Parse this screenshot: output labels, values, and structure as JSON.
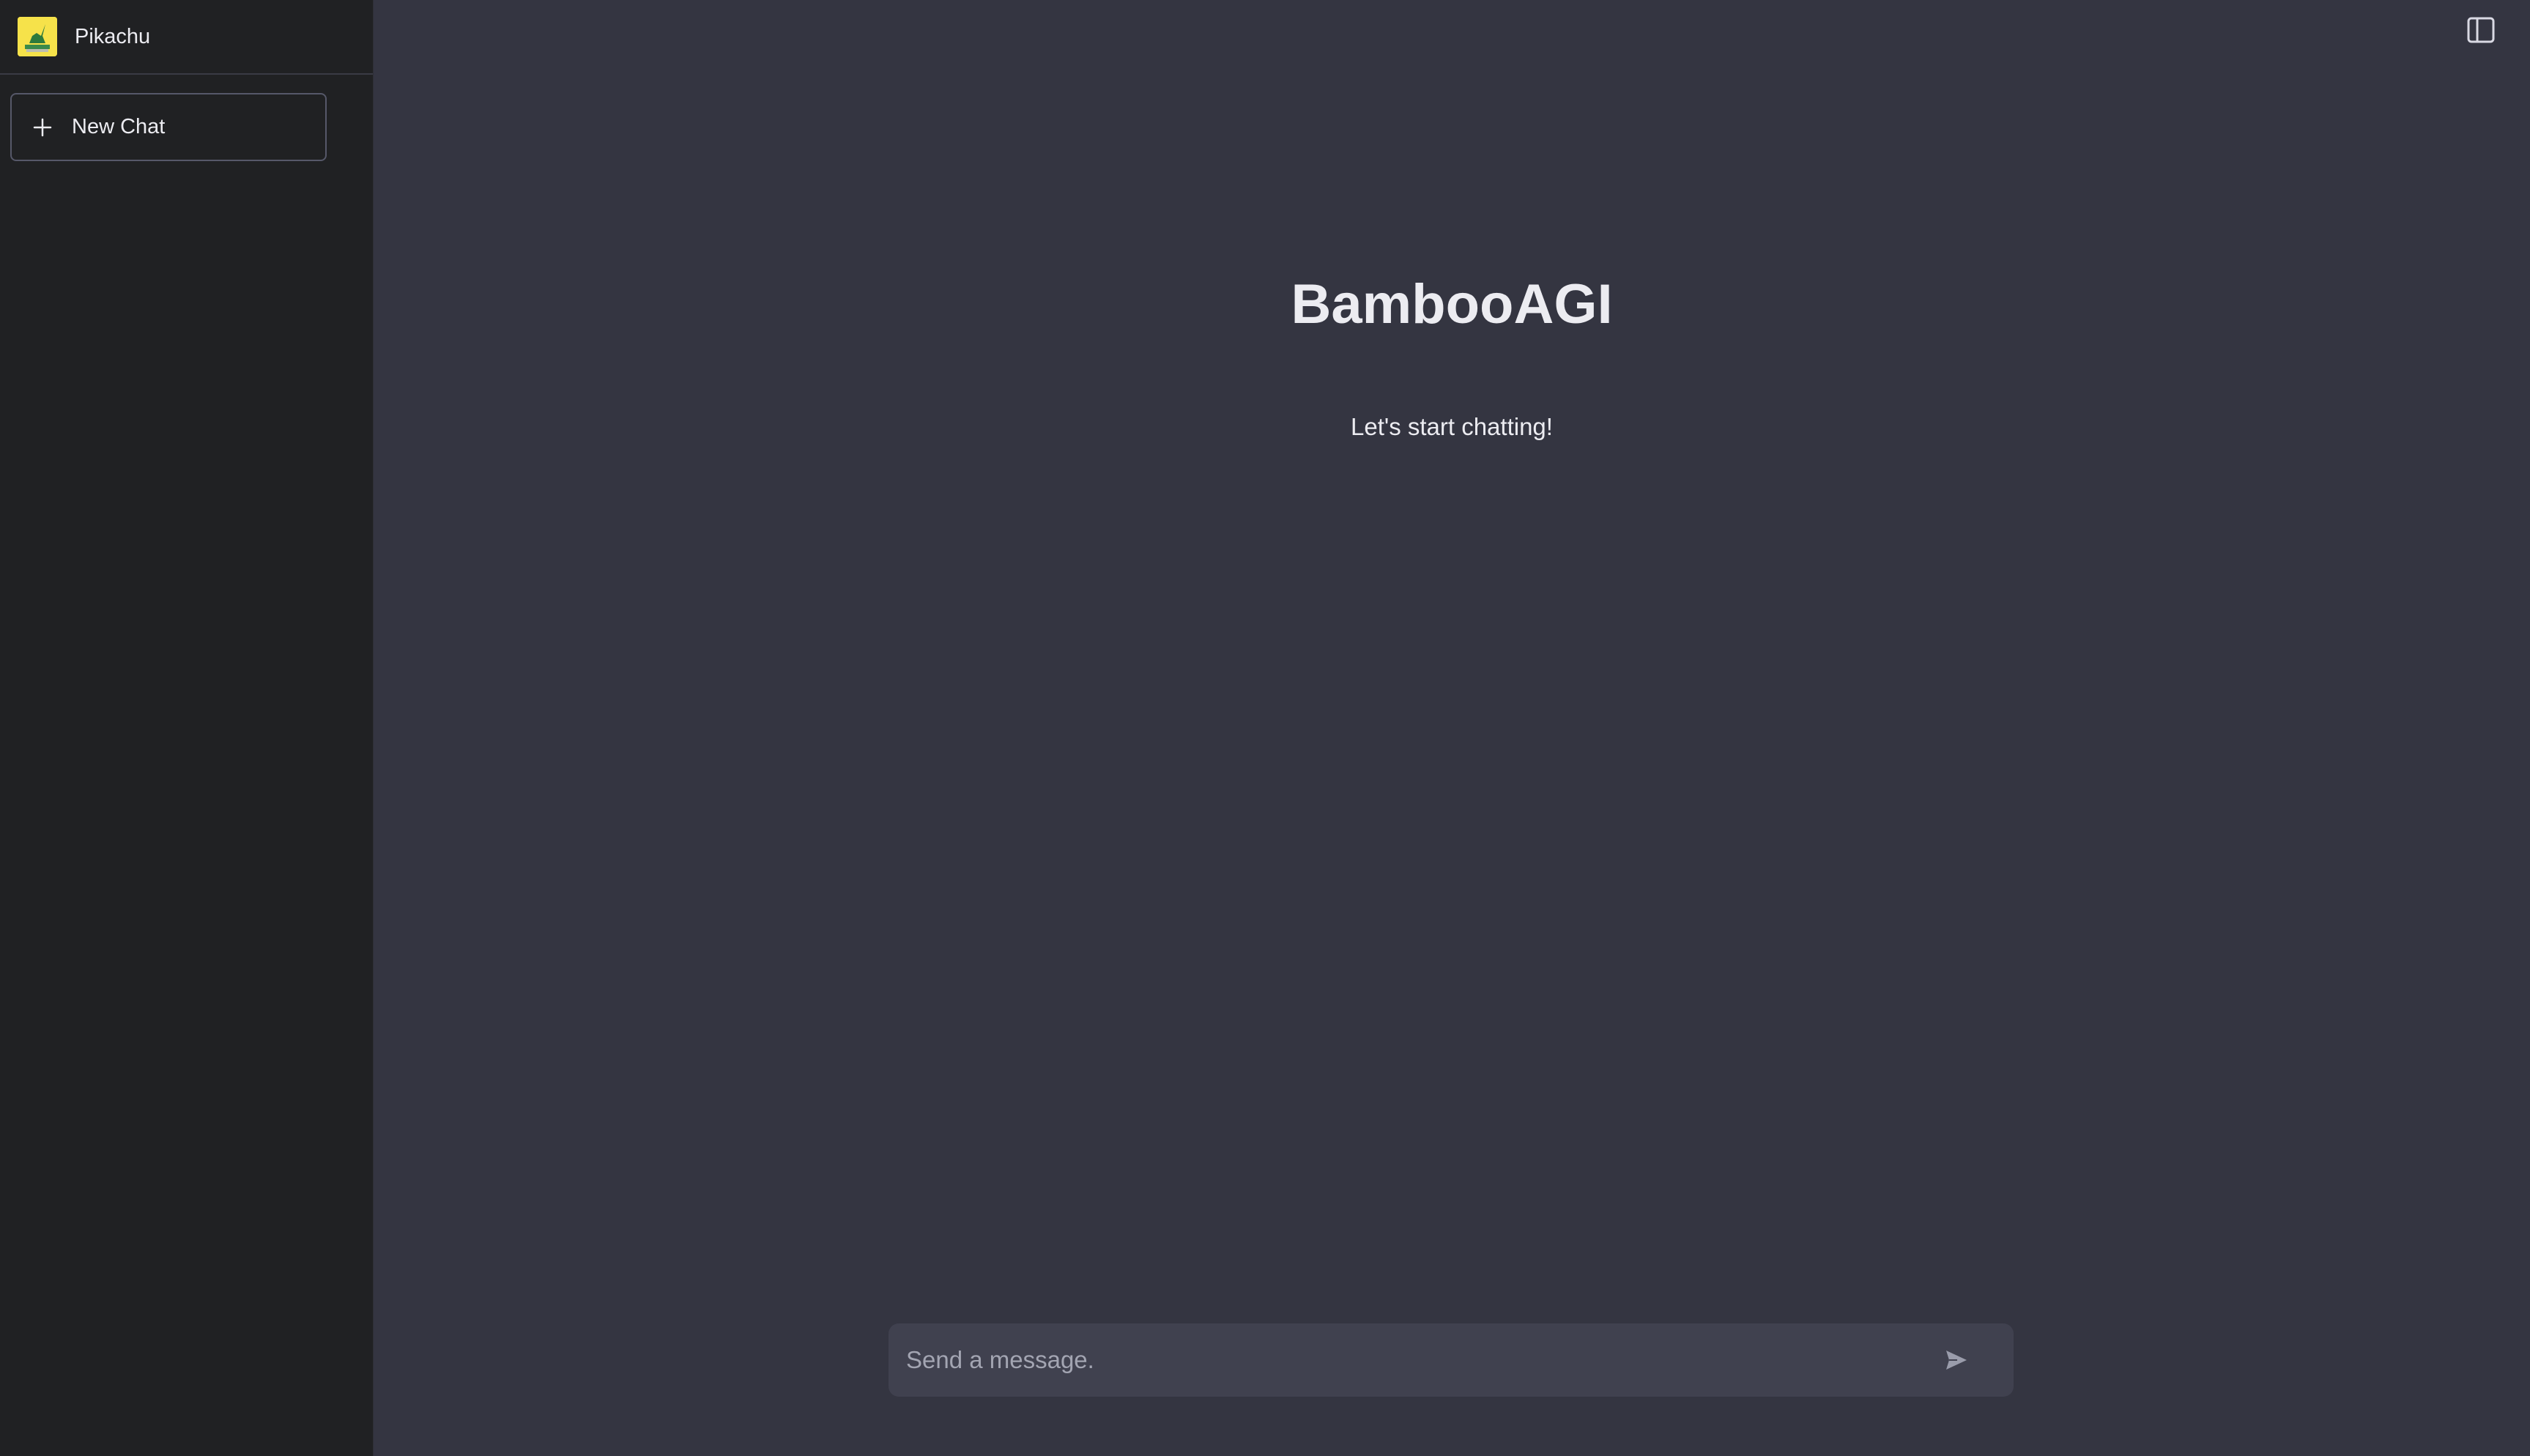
{
  "sidebar": {
    "user_name": "Pikachu",
    "new_chat_label": "New Chat"
  },
  "main": {
    "title": "BambooAGI",
    "subtitle": "Let's start chatting!"
  },
  "composer": {
    "placeholder": "Send a message."
  },
  "icons": {
    "avatar": "pikachu-avatar",
    "new_chat": "plus-icon",
    "sidebar_toggle": "sidebar-toggle-icon",
    "send": "send-icon"
  },
  "colors": {
    "sidebar_bg": "#202123",
    "main_bg": "#343541",
    "composer_bg": "#40414f",
    "avatar_bg": "#f6e24a"
  }
}
